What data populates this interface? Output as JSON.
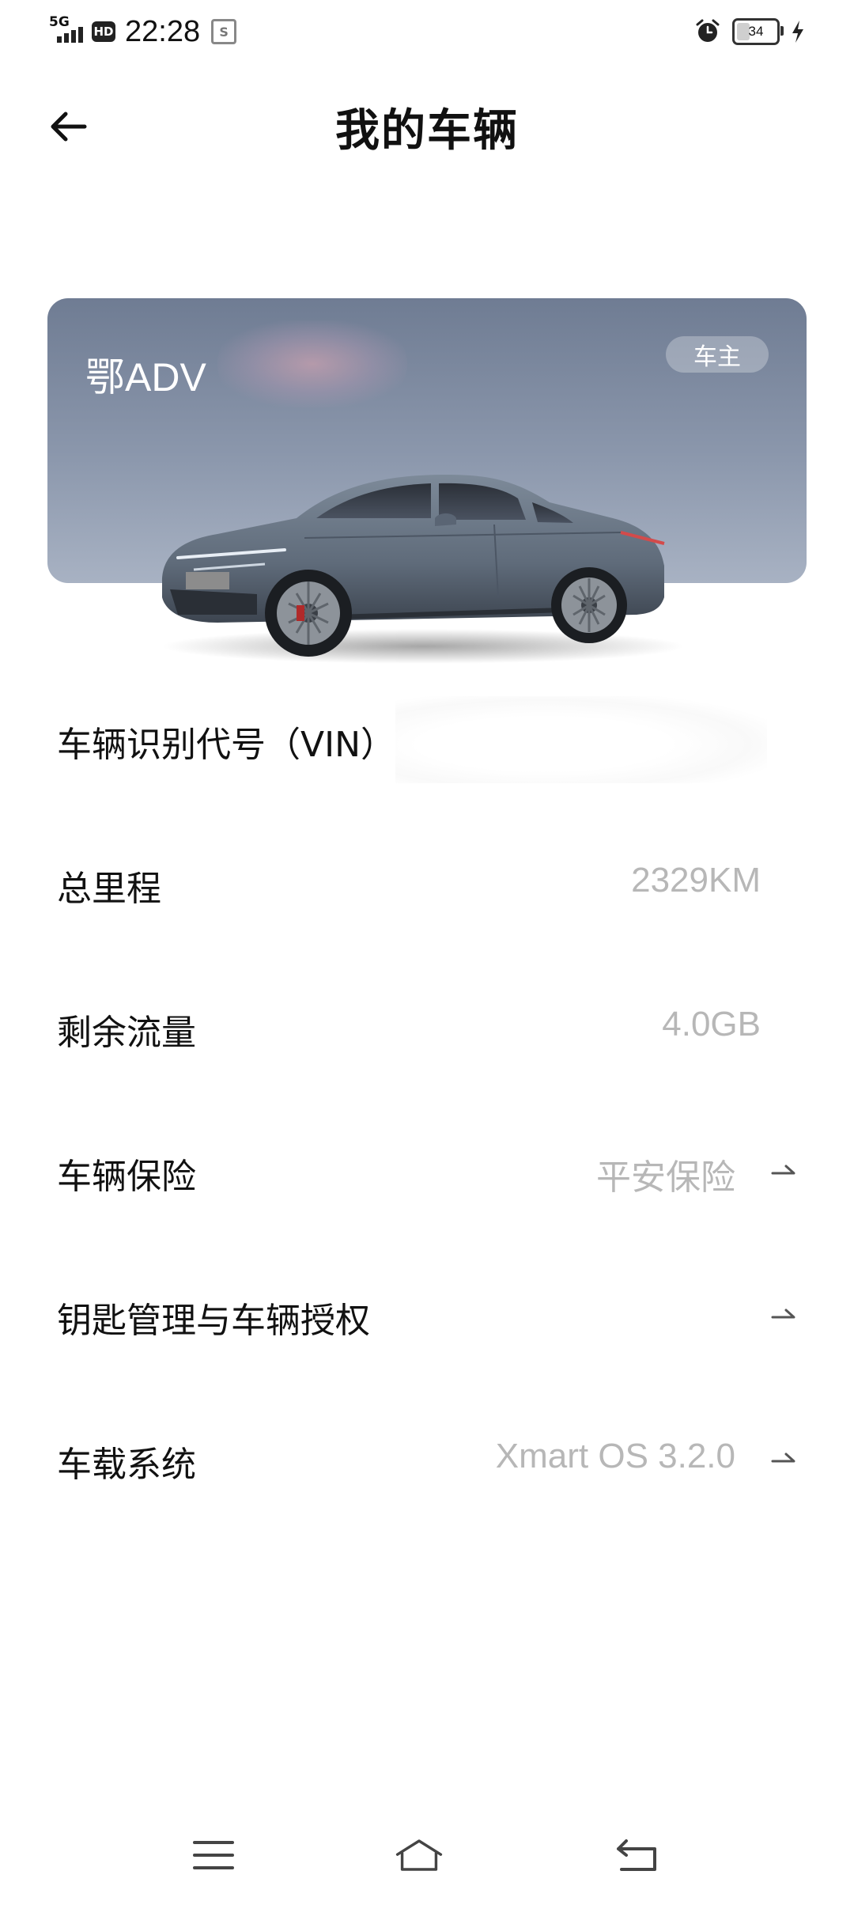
{
  "status_bar": {
    "network": "5G",
    "hd": "HD",
    "time": "22:28",
    "sim_icon": "S",
    "battery_level": "34",
    "battery_fraction": 0.34,
    "icons": [
      "signal-icon",
      "hd-icon",
      "sim-icon",
      "alarm-icon",
      "battery-icon",
      "charging-icon"
    ]
  },
  "header": {
    "title": "我的车辆",
    "back_icon": "arrow-left-icon"
  },
  "vehicle": {
    "plate": "鄂ADV",
    "role_badge": "车主"
  },
  "info_rows": [
    {
      "label": "车辆识别代号（VIN）",
      "value": "",
      "has_arrow": false
    },
    {
      "label": "总里程",
      "value": "2329KM",
      "has_arrow": false
    },
    {
      "label": "剩余流量",
      "value": "4.0GB",
      "has_arrow": false
    },
    {
      "label": "车辆保险",
      "value": "平安保险",
      "has_arrow": true
    },
    {
      "label": "钥匙管理与车辆授权",
      "value": "",
      "has_arrow": true
    },
    {
      "label": "车载系统",
      "value": "Xmart OS 3.2.0",
      "has_arrow": true
    }
  ],
  "nav": {
    "icons": [
      "menu-icon",
      "home-icon",
      "back-icon"
    ]
  },
  "colors": {
    "card_gradient_top": "#6f7c93",
    "card_gradient_bottom": "#a8b2c3",
    "value_text": "#b7b7b7",
    "car_body": "#6b7888"
  }
}
